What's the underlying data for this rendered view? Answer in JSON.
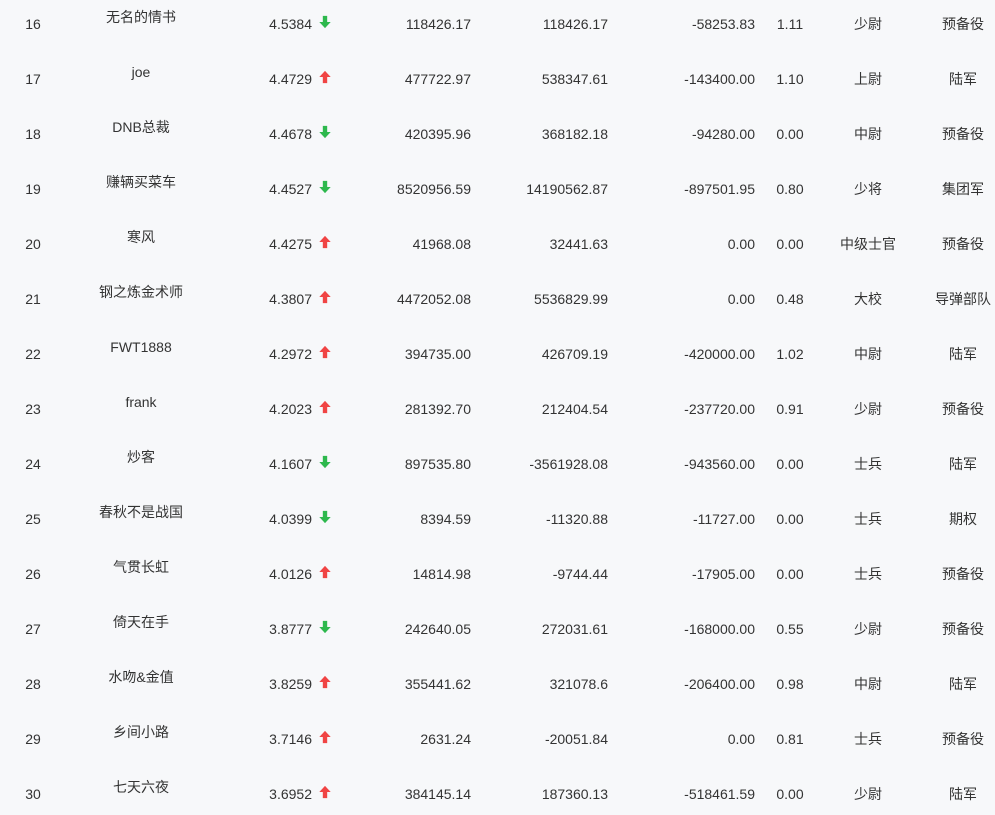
{
  "colors": {
    "background": "#f7f8fa",
    "text": "#333333",
    "arrow_up": "#f04444",
    "arrow_down": "#2db84d"
  },
  "rows": [
    {
      "rank": "16",
      "name": "无名的情书",
      "score": "4.5384",
      "trend": "down",
      "value1": "118426.17",
      "value2": "118426.17",
      "value3": "-58253.83",
      "ratio": "1.11",
      "military_rank": "少尉",
      "unit": "预备役"
    },
    {
      "rank": "17",
      "name": "joe",
      "score": "4.4729",
      "trend": "up",
      "value1": "477722.97",
      "value2": "538347.61",
      "value3": "-143400.00",
      "ratio": "1.10",
      "military_rank": "上尉",
      "unit": "陆军"
    },
    {
      "rank": "18",
      "name": "DNB总裁",
      "score": "4.4678",
      "trend": "down",
      "value1": "420395.96",
      "value2": "368182.18",
      "value3": "-94280.00",
      "ratio": "0.00",
      "military_rank": "中尉",
      "unit": "预备役"
    },
    {
      "rank": "19",
      "name": "赚辆买菜车",
      "score": "4.4527",
      "trend": "down",
      "value1": "8520956.59",
      "value2": "14190562.87",
      "value3": "-897501.95",
      "ratio": "0.80",
      "military_rank": "少将",
      "unit": "集团军"
    },
    {
      "rank": "20",
      "name": "寒风",
      "score": "4.4275",
      "trend": "up",
      "value1": "41968.08",
      "value2": "32441.63",
      "value3": "0.00",
      "ratio": "0.00",
      "military_rank": "中级士官",
      "unit": "预备役"
    },
    {
      "rank": "21",
      "name": "钢之炼金术师",
      "score": "4.3807",
      "trend": "up",
      "value1": "4472052.08",
      "value2": "5536829.99",
      "value3": "0.00",
      "ratio": "0.48",
      "military_rank": "大校",
      "unit": "导弹部队"
    },
    {
      "rank": "22",
      "name": "FWT1888",
      "score": "4.2972",
      "trend": "up",
      "value1": "394735.00",
      "value2": "426709.19",
      "value3": "-420000.00",
      "ratio": "1.02",
      "military_rank": "中尉",
      "unit": "陆军"
    },
    {
      "rank": "23",
      "name": "frank",
      "score": "4.2023",
      "trend": "up",
      "value1": "281392.70",
      "value2": "212404.54",
      "value3": "-237720.00",
      "ratio": "0.91",
      "military_rank": "少尉",
      "unit": "预备役"
    },
    {
      "rank": "24",
      "name": "炒客",
      "score": "4.1607",
      "trend": "down",
      "value1": "897535.80",
      "value2": "-3561928.08",
      "value3": "-943560.00",
      "ratio": "0.00",
      "military_rank": "士兵",
      "unit": "陆军"
    },
    {
      "rank": "25",
      "name": "春秋不是战国",
      "score": "4.0399",
      "trend": "down",
      "value1": "8394.59",
      "value2": "-11320.88",
      "value3": "-11727.00",
      "ratio": "0.00",
      "military_rank": "士兵",
      "unit": "期权"
    },
    {
      "rank": "26",
      "name": "气贯长虹",
      "score": "4.0126",
      "trend": "up",
      "value1": "14814.98",
      "value2": "-9744.44",
      "value3": "-17905.00",
      "ratio": "0.00",
      "military_rank": "士兵",
      "unit": "预备役"
    },
    {
      "rank": "27",
      "name": "倚天在手",
      "score": "3.8777",
      "trend": "down",
      "value1": "242640.05",
      "value2": "272031.61",
      "value3": "-168000.00",
      "ratio": "0.55",
      "military_rank": "少尉",
      "unit": "预备役"
    },
    {
      "rank": "28",
      "name": "水吻&金值",
      "score": "3.8259",
      "trend": "up",
      "value1": "355441.62",
      "value2": "321078.6",
      "value3": "-206400.00",
      "ratio": "0.98",
      "military_rank": "中尉",
      "unit": "陆军"
    },
    {
      "rank": "29",
      "name": "乡间小路",
      "score": "3.7146",
      "trend": "up",
      "value1": "2631.24",
      "value2": "-20051.84",
      "value3": "0.00",
      "ratio": "0.81",
      "military_rank": "士兵",
      "unit": "预备役"
    },
    {
      "rank": "30",
      "name": "七天六夜",
      "score": "3.6952",
      "trend": "up",
      "value1": "384145.14",
      "value2": "187360.13",
      "value3": "-518461.59",
      "ratio": "0.00",
      "military_rank": "少尉",
      "unit": "陆军"
    }
  ]
}
